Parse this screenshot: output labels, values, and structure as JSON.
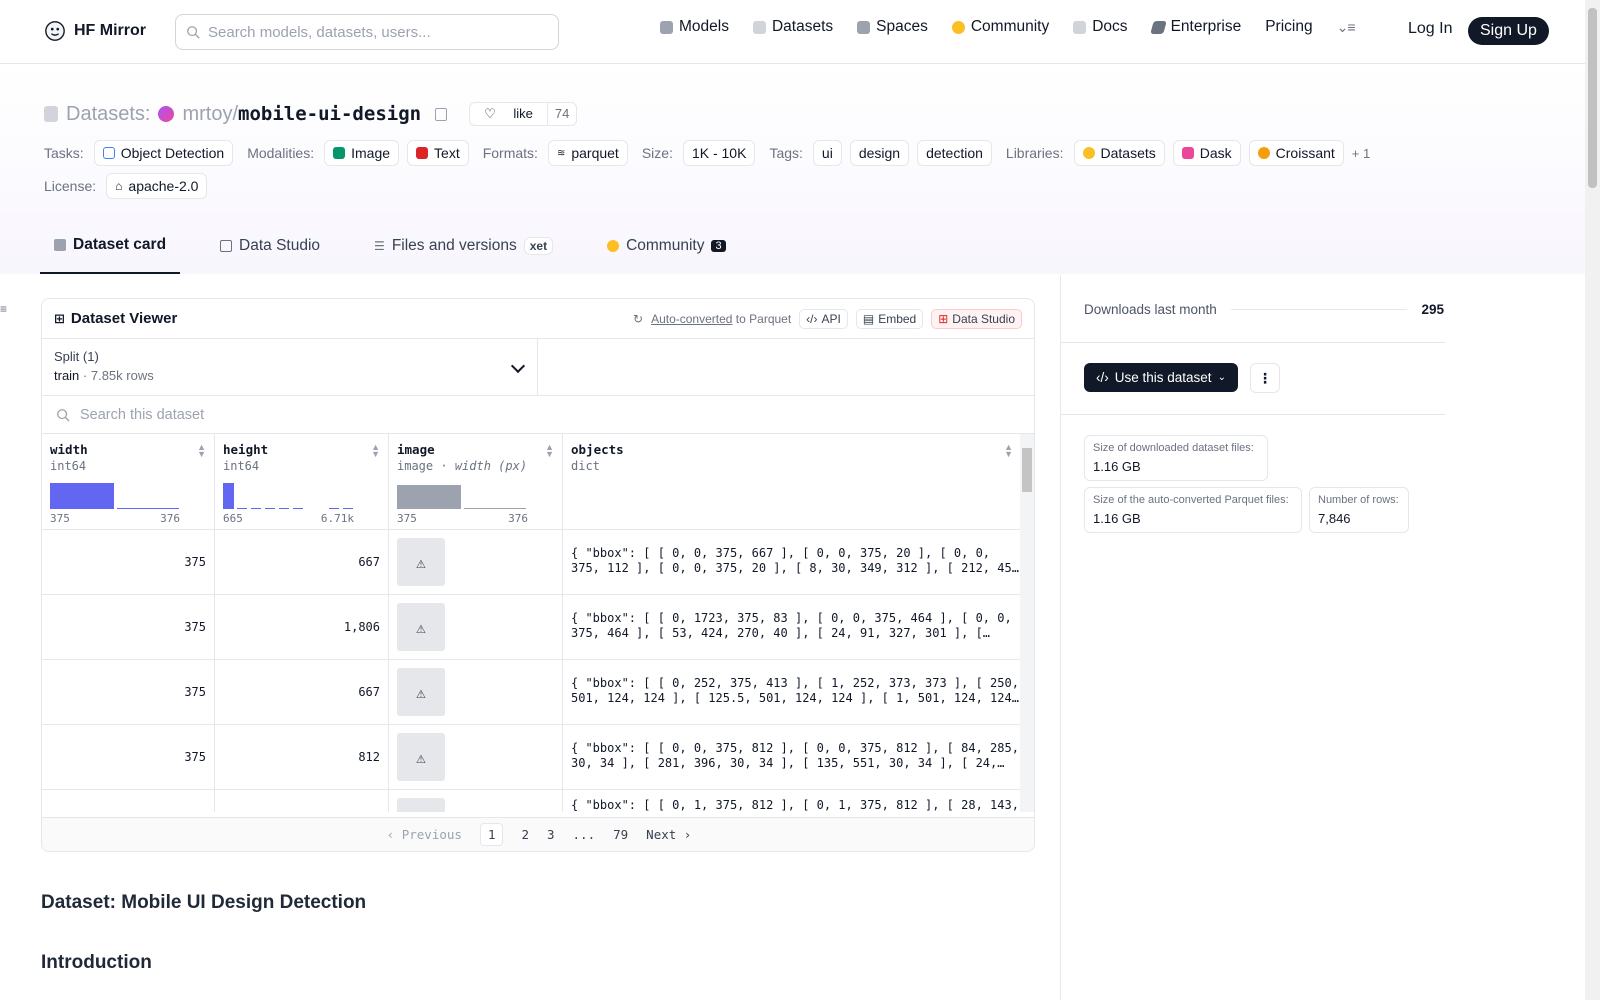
{
  "brand": {
    "name": "HF Mirror"
  },
  "search": {
    "placeholder": "Search models, datasets, users..."
  },
  "nav": {
    "items": [
      {
        "label": "Models",
        "icon": "cube-icon",
        "color": "#9ca3af"
      },
      {
        "label": "Datasets",
        "icon": "database-icon",
        "color": "#d1d5db"
      },
      {
        "label": "Spaces",
        "icon": "grid-icon",
        "color": "#9ca3af"
      },
      {
        "label": "Community",
        "icon": "hf-emoji-icon",
        "color": "#fbbf24"
      },
      {
        "label": "Docs",
        "icon": "book-icon",
        "color": "#d1d5db"
      },
      {
        "label": "Enterprise",
        "icon": "enterprise-icon",
        "color": "#6b7280"
      },
      {
        "label": "Pricing"
      }
    ],
    "login": "Log In",
    "signup": "Sign Up"
  },
  "repo": {
    "section": "Datasets:",
    "owner": "mrtoy",
    "slash": "/",
    "name": "mobile-ui-design",
    "like_label": "like",
    "like_count": "74"
  },
  "meta": {
    "tasks_label": "Tasks:",
    "task": "Object Detection",
    "modalities_label": "Modalities:",
    "modalities": [
      "Image",
      "Text"
    ],
    "formats_label": "Formats:",
    "format": "parquet",
    "size_label": "Size:",
    "size": "1K - 10K",
    "tags_label": "Tags:",
    "tags": [
      "ui",
      "design",
      "detection"
    ],
    "libraries_label": "Libraries:",
    "libraries": [
      "Datasets",
      "Dask",
      "Croissant"
    ],
    "libraries_more": "+ 1",
    "license_label": "License:",
    "license": "apache-2.0"
  },
  "tabs": [
    {
      "label": "Dataset card"
    },
    {
      "label": "Data Studio"
    },
    {
      "label": "Files and versions",
      "badge": "xet"
    },
    {
      "label": "Community",
      "count": "3"
    }
  ],
  "viewer": {
    "title": "Dataset Viewer",
    "auto_converted": "Auto-converted",
    "to_parquet": "to Parquet",
    "api": "API",
    "embed": "Embed",
    "data_studio": "Data Studio",
    "split_label": "Split (1)",
    "split_name": "train",
    "split_rows": "7.85k rows",
    "search_placeholder": "Search this dataset",
    "columns": [
      {
        "name": "width",
        "type": "int64",
        "min": "375",
        "max": "376"
      },
      {
        "name": "height",
        "type": "int64",
        "min": "665",
        "max": "6.71k"
      },
      {
        "name": "image",
        "type": "image",
        "type_extra": "width (px)",
        "min": "375",
        "max": "376"
      },
      {
        "name": "objects",
        "type": "dict"
      }
    ],
    "rows": [
      {
        "width": "375",
        "height": "667",
        "objects": "{ \"bbox\": [ [ 0, 0, 375, 667 ], [ 0, 0, 375, 20 ], [ 0, 0,\n375, 112 ], [ 0, 0, 375, 20 ], [ 8, 30, 349, 312 ], [ 212, 45…"
      },
      {
        "width": "375",
        "height": "1,806",
        "objects": "{ \"bbox\": [ [ 0, 1723, 375, 83 ], [ 0, 0, 375, 464 ], [ 0, 0,\n375, 464 ], [ 53, 424, 270, 40 ], [ 24, 91, 327, 301 ], […"
      },
      {
        "width": "375",
        "height": "667",
        "objects": "{ \"bbox\": [ [ 0, 252, 375, 413 ], [ 1, 252, 373, 373 ], [ 250,\n501, 124, 124 ], [ 125.5, 501, 124, 124 ], [ 1, 501, 124, 124…"
      },
      {
        "width": "375",
        "height": "812",
        "objects": "{ \"bbox\": [ [ 0, 0, 375, 812 ], [ 0, 0, 375, 812 ], [ 84, 285,\n30, 34 ], [ 281, 396, 30, 34 ], [ 135, 551, 30, 34 ], [ 24,…"
      },
      {
        "width": "",
        "height": "",
        "objects": "{ \"bbox\": [ [ 0, 1, 375, 812 ], [ 0, 1, 375, 812 ], [ 28, 143,"
      }
    ],
    "pager": {
      "prev": "Previous",
      "pages": [
        "1",
        "2",
        "3",
        "...",
        "79"
      ],
      "next": "Next"
    }
  },
  "card": {
    "heading": "Dataset: Mobile UI Design Detection",
    "intro": "Introduction"
  },
  "sidebar": {
    "downloads_label": "Downloads last month",
    "downloads": "295",
    "use_button": "Use this dataset",
    "download_size_label": "Size of downloaded dataset files:",
    "download_size": "1.16 GB",
    "parquet_size_label": "Size of the auto-converted Parquet files:",
    "parquet_size": "1.16 GB",
    "rows_label": "Number of rows:",
    "rows": "7,846"
  }
}
